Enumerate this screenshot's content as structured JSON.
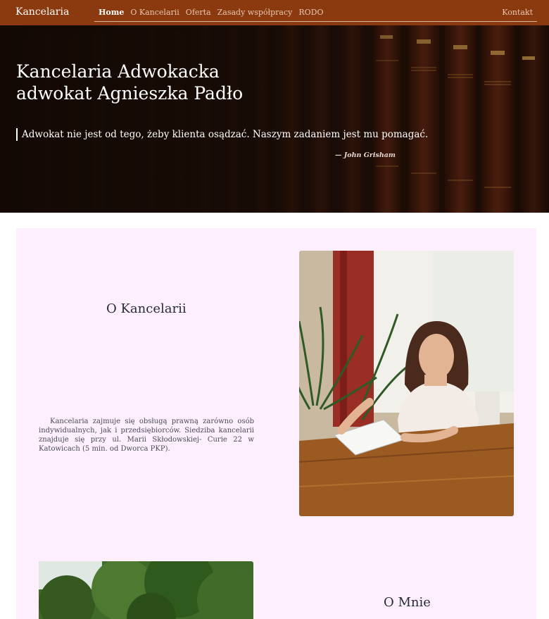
{
  "navbar": {
    "brand": "Kancelaria",
    "links": [
      {
        "label": "Home",
        "active": true
      },
      {
        "label": "O Kancelarii",
        "active": false
      },
      {
        "label": "Oferta",
        "active": false
      },
      {
        "label": "Zasady współpracy",
        "active": false
      },
      {
        "label": "RODO",
        "active": false
      }
    ],
    "contact": "Kontakt"
  },
  "hero": {
    "title_line1": "Kancelaria Adwokacka",
    "title_line2": "adwokat Agnieszka Padło",
    "quote": "Adwokat nie jest od tego, żeby klienta osądzać. Naszym zadaniem jest mu pomagać.",
    "cite": "— John Grisham"
  },
  "about": {
    "title": "O Kancelarii",
    "text": "Kancelaria zajmuje się obsługą prawną zarówno osób indywidualnych, jak i przedsiębiorców. Siedziba kancelarii znajduje się przy ul. Marii Skłodowskiej- Curie 22 w Katowicach (5 min. od Dworca PKP)."
  },
  "me": {
    "title": "O Mnie"
  },
  "colors": {
    "navbar": "#8a3a0e",
    "content_bg": "#fdeffd",
    "heading": "#262a3a"
  }
}
